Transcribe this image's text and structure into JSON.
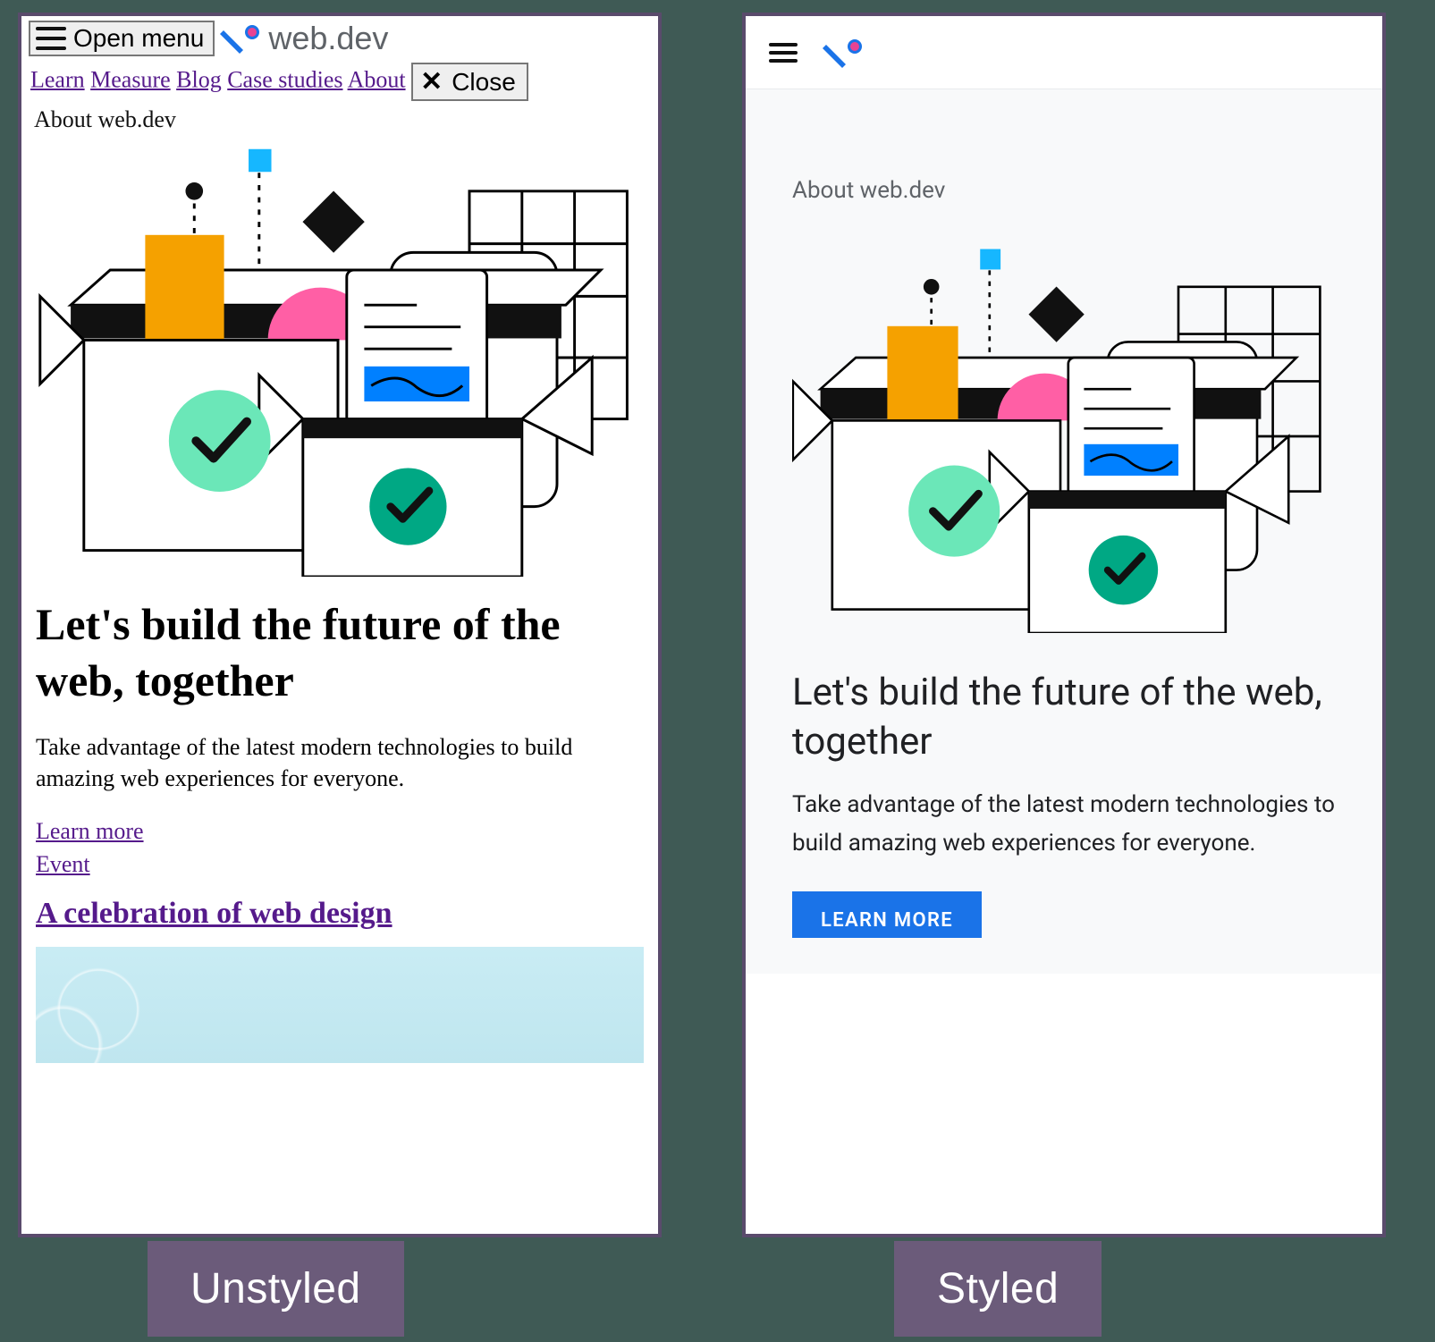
{
  "logo_text": "web.dev",
  "open_menu_label": "Open menu",
  "close_label": "Close",
  "nav": {
    "learn": "Learn",
    "measure": "Measure",
    "blog": "Blog",
    "case_studies": "Case studies",
    "about": "About"
  },
  "eyebrow": "About web.dev",
  "headline": "Let's build the future of the web, together",
  "subhead": "Take advantage of the latest modern technologies to build amazing web experiences for everyone.",
  "learn_more_link": "Learn more",
  "event_link": "Event",
  "event_heading": "A celebration of web design",
  "learn_more_button": "LEARN MORE",
  "captions": {
    "unstyled": "Unstyled",
    "styled": "Styled"
  }
}
